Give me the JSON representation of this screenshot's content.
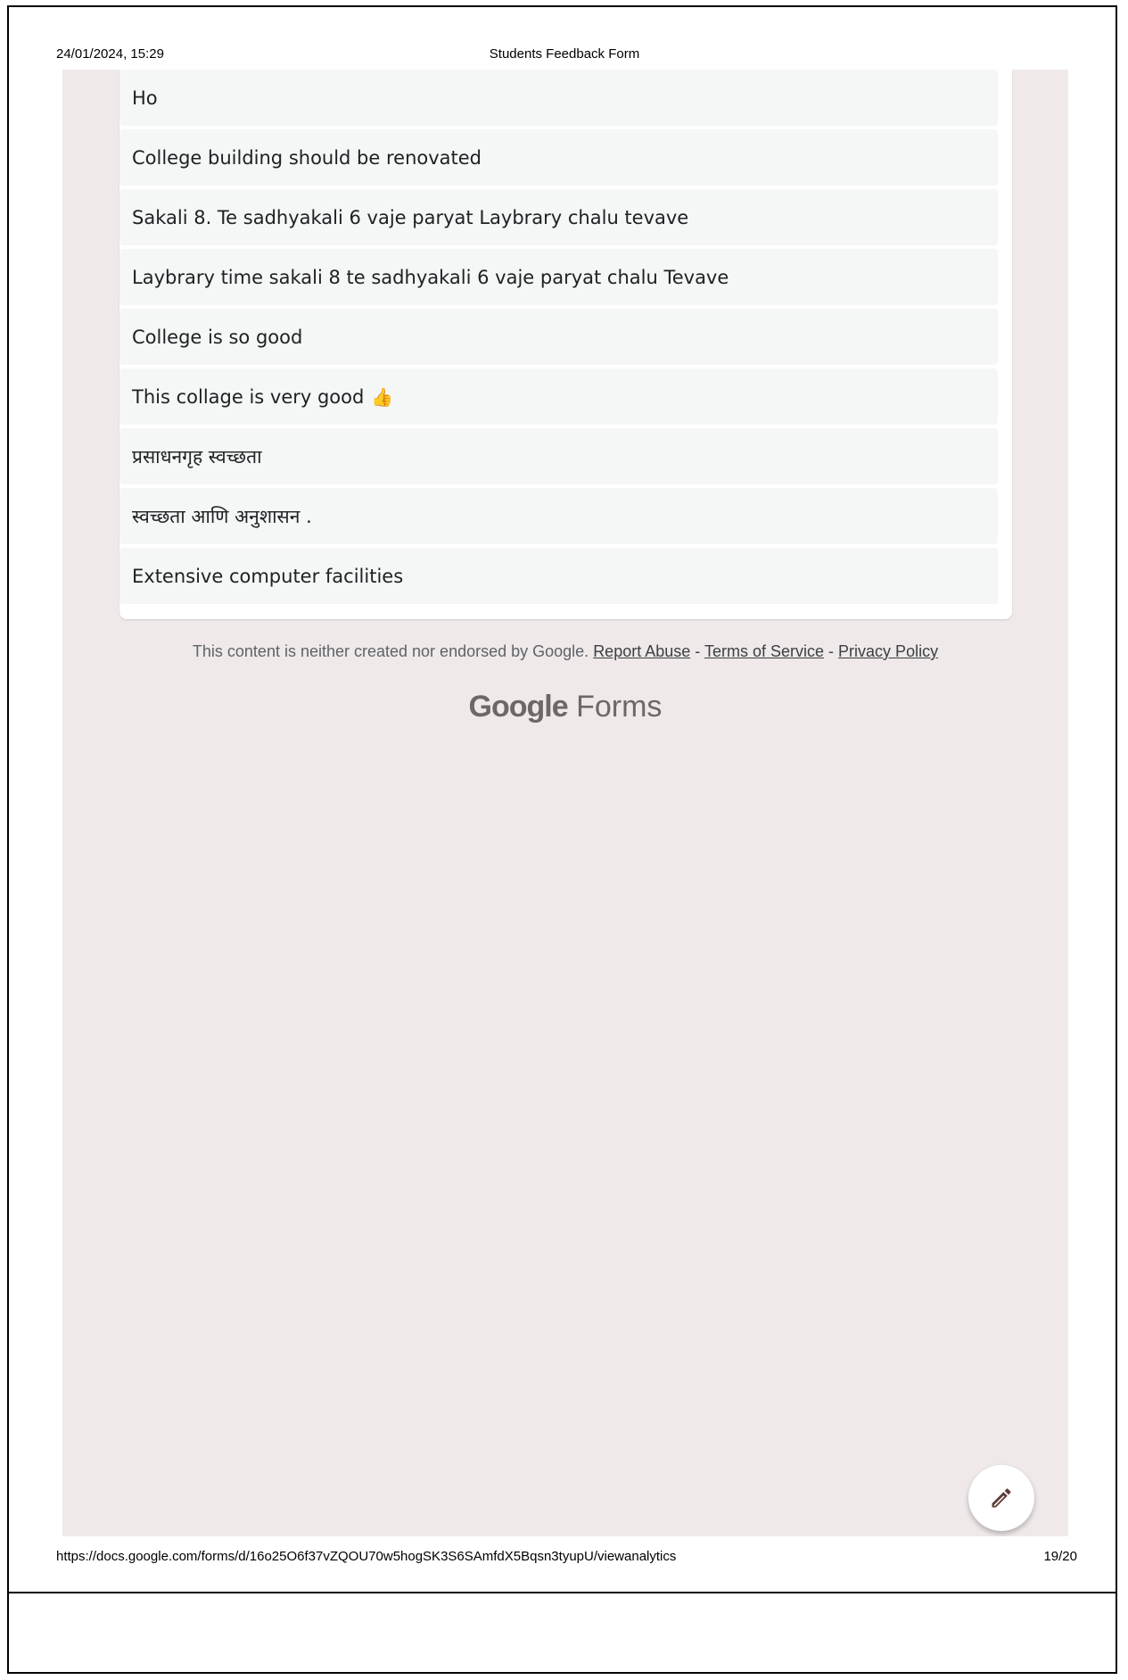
{
  "print_header": {
    "datetime": "24/01/2024, 15:29",
    "title": "Students Feedback Form"
  },
  "responses": [
    {
      "text": "Ho"
    },
    {
      "text": "College building should be renovated"
    },
    {
      "text": "Sakali 8. Te sadhyakali 6 vaje paryat Laybrary chalu tevave"
    },
    {
      "text": "Laybrary time sakali 8 te sadhyakali 6 vaje paryat chalu Tevave"
    },
    {
      "text": "College is so good"
    },
    {
      "text": "This collage is very good",
      "emoji": "👍"
    },
    {
      "text": "प्रसाधनगृह स्वच्छता"
    },
    {
      "text": "स्वच्छता आणि अनुशासन ."
    },
    {
      "text": "Extensive computer facilities"
    }
  ],
  "footer": {
    "disclaimer": "This content is neither created nor endorsed by Google.",
    "report_abuse": "Report Abuse",
    "separator": "-",
    "terms": "Terms of Service",
    "privacy": "Privacy Policy"
  },
  "brand": {
    "google": "Google",
    "forms": "Forms"
  },
  "fab": {
    "icon": "pencil-icon"
  },
  "print_footer": {
    "url": "https://docs.google.com/forms/d/16o25O6f37vZQOU70w5hogSK3S6SAmfdX5Bqsn3tyupU/viewanalytics",
    "page": "19/20"
  },
  "colors": {
    "background": "#efe9e9",
    "card": "#ffffff",
    "response_bg": "#f5f6f6",
    "fab_icon": "#5f3b3b"
  }
}
